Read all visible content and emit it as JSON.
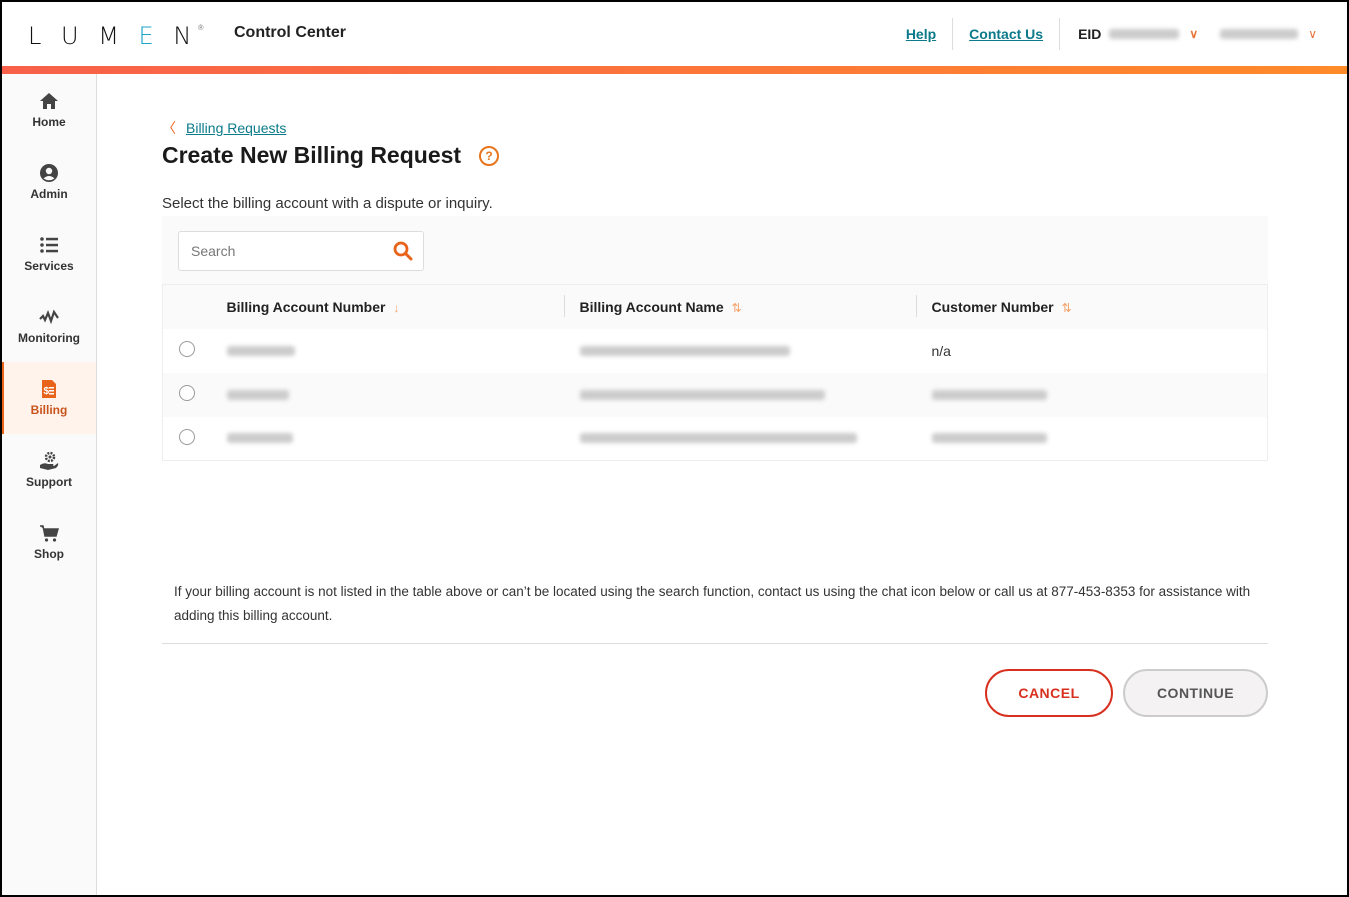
{
  "header": {
    "logo": "LUMEN",
    "app_title": "Control Center",
    "links": {
      "help": "Help",
      "contact": "Contact Us"
    },
    "eid_label": "EID",
    "eid_value": "[redacted]",
    "user_name": "[redacted]"
  },
  "sidebar": {
    "items": [
      {
        "label": "Home",
        "icon": "home-icon"
      },
      {
        "label": "Admin",
        "icon": "user-circle-icon"
      },
      {
        "label": "Services",
        "icon": "list-icon"
      },
      {
        "label": "Monitoring",
        "icon": "pulse-icon"
      },
      {
        "label": "Billing",
        "icon": "billing-doc-icon",
        "active": true
      },
      {
        "label": "Support",
        "icon": "support-hand-gear-icon"
      },
      {
        "label": "Shop",
        "icon": "cart-icon"
      }
    ]
  },
  "main": {
    "breadcrumb": "Billing Requests",
    "title": "Create New Billing Request",
    "instruction": "Select the billing account with a dispute or inquiry.",
    "search": {
      "placeholder": "Search",
      "value": ""
    },
    "table": {
      "columns": [
        {
          "label": "Billing Account Number",
          "sort": "descending"
        },
        {
          "label": "Billing Account Name",
          "sort": "none"
        },
        {
          "label": "Customer Number",
          "sort": "none"
        }
      ],
      "rows": [
        {
          "account_number": "[redacted]",
          "account_name": "[redacted]",
          "customer_number": "n/a",
          "selected": false
        },
        {
          "account_number": "[redacted]",
          "account_name": "[redacted]",
          "customer_number": "[redacted]",
          "selected": false
        },
        {
          "account_number": "[redacted]",
          "account_name": "[redacted]",
          "customer_number": "[redacted]",
          "selected": false
        }
      ]
    },
    "note": "If your billing account is not listed in the table above or can’t be located using the search function, contact us using the chat icon below or call us at 877-453-8353 for assistance with adding this billing account.",
    "buttons": {
      "cancel": "CANCEL",
      "continue": "CONTINUE"
    }
  },
  "colors": {
    "accent": "#e8641b",
    "link": "#0b7a8a",
    "cancel": "#d8301f"
  }
}
